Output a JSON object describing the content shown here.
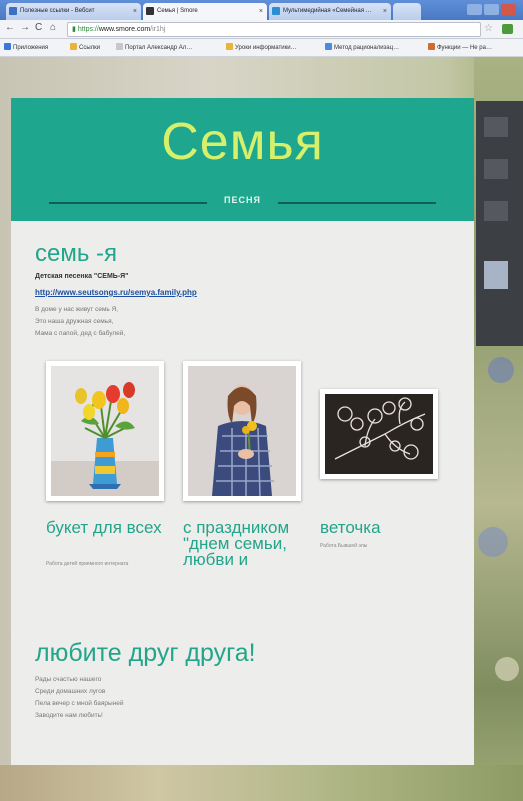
{
  "browser": {
    "tabs": [
      {
        "label": "Полезные ссылки - Вебсит"
      },
      {
        "label": "Семья | Smore"
      },
      {
        "label": "Мультимедийная «Семейная …"
      }
    ],
    "url": {
      "protocol": "https://",
      "host": "www.smore.com",
      "path": "/ir1hj"
    },
    "bookmarks": [
      {
        "label": "Приложения",
        "color": "#3b78d8"
      },
      {
        "label": "Ссылки",
        "color": "#e8b43a"
      },
      {
        "label": "Портал Александр Ал…",
        "color": "#c8c8c8"
      },
      {
        "label": "Уроки информатики…",
        "color": "#e8b43a"
      },
      {
        "label": "Метод рационализац…",
        "color": "#4a8adf"
      },
      {
        "label": "Функции — Не ра…",
        "color": "#d06b2f"
      }
    ]
  },
  "flyer": {
    "title": "Семья",
    "subtitle": "ПЕСНЯ",
    "section1": {
      "heading": "семь -я",
      "bold": "Детская песенка \"СЕМЬ-Я\"",
      "link": "http://www.seutsongs.ru/semya.family.php",
      "lines": [
        "В доме у нас живут семь Я,",
        "Это наша дружная семья,",
        "Мама с папой, дед с бабулей,"
      ]
    },
    "gallery": [
      {
        "title": "букет для всех",
        "desc": "Работа детей приемного интерната"
      },
      {
        "title": "с праздником \"днем семьи, любви и",
        "desc": ""
      },
      {
        "title": "веточка",
        "desc": "Работа Бывшей элы"
      }
    ],
    "section2": {
      "heading": "любите друг друга!",
      "lines": [
        "Рады счастью нашего",
        "Среди домашних лугов",
        "Пела вечер с мной баярыней",
        "Заводите нам любить!"
      ]
    }
  },
  "colors": {
    "accent": "#1ea78e",
    "title": "#d6f06c",
    "heading": "#22a58a"
  }
}
